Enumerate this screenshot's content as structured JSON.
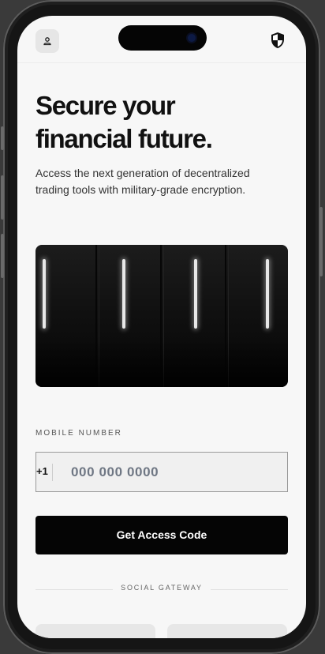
{
  "header": {
    "profile_icon": "person-icon",
    "security_icon": "shield-icon"
  },
  "hero": {
    "title_line1": "Secure your",
    "title_line2": "financial future.",
    "subtitle": "Access the next generation of decentralized trading tools with military-grade encryption."
  },
  "form": {
    "label": "MOBILE NUMBER",
    "country_code": "+1",
    "phone_placeholder": "000 000 0000",
    "submit_label": "Get Access Code"
  },
  "social": {
    "divider_label": "SOCIAL GATEWAY"
  },
  "colors": {
    "background": "#f7f7f7",
    "primary": "#050505",
    "text": "#111111"
  }
}
